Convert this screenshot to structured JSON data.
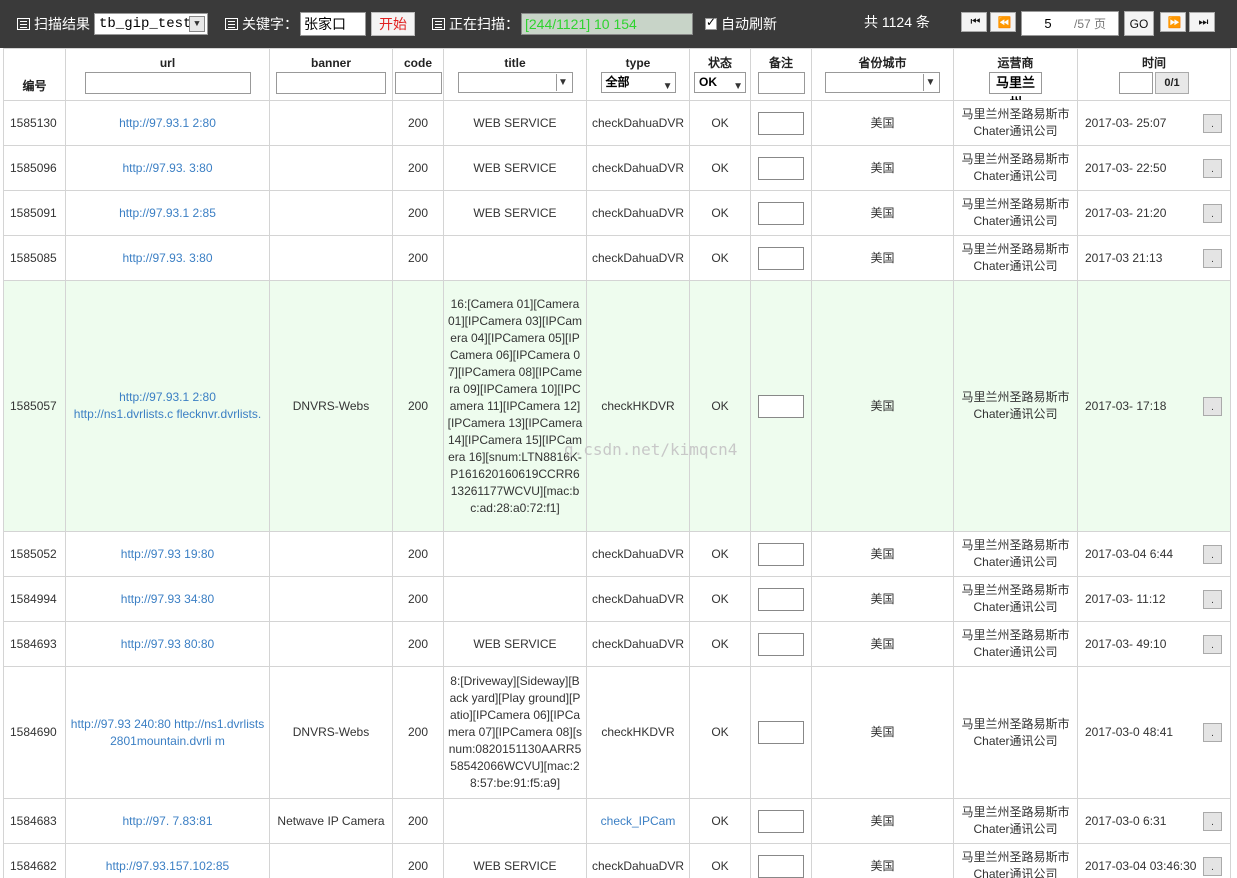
{
  "toolbar": {
    "scan_result_label": "扫描结果",
    "db_select_value": "tb_gip_test",
    "keyword_label": "关键字：",
    "keyword_value": "张家口",
    "start_button": "开始",
    "scanning_label": "正在扫描：",
    "scanning_progress": "[244/1121] 10          154",
    "auto_refresh_label": "自动刷新",
    "total_label": "共 1124 条",
    "first_page": "⏮",
    "prev_page": "⏪",
    "current_page": "5",
    "total_pages": "/57 页",
    "go_button": "GO",
    "next_page": "⏩",
    "last_page": "⏭"
  },
  "table": {
    "headers": {
      "id": "编号",
      "url": "url",
      "banner": "banner",
      "code": "code",
      "title": "title",
      "type": "type",
      "status": "状态",
      "note": "备注",
      "region": "省份城市",
      "isp": "运营商",
      "time": "时间"
    },
    "filters": {
      "type_value": "全部",
      "status_value": "OK",
      "isp_value": "马里兰州",
      "time_page": "0/1"
    },
    "rows": [
      {
        "id": "1585130",
        "url": "http://97.93.1      2:80",
        "banner": "",
        "code": "200",
        "title": "WEB SERVICE",
        "type": "checkDahuaDVR",
        "status": "OK",
        "region": "美国",
        "isp": "马里兰州圣路易斯市Chater通讯公司",
        "time": "2017-03-        25:07"
      },
      {
        "id": "1585096",
        "url": "http://97.93.      3:80",
        "banner": "",
        "code": "200",
        "title": "WEB SERVICE",
        "type": "checkDahuaDVR",
        "status": "OK",
        "region": "美国",
        "isp": "马里兰州圣路易斯市Chater通讯公司",
        "time": "2017-03-        22:50"
      },
      {
        "id": "1585091",
        "url": "http://97.93.1      2:85",
        "banner": "",
        "code": "200",
        "title": "WEB SERVICE",
        "type": "checkDahuaDVR",
        "status": "OK",
        "region": "美国",
        "isp": "马里兰州圣路易斯市Chater通讯公司",
        "time": "2017-03-        21:20"
      },
      {
        "id": "1585085",
        "url": "http://97.93.      3:80",
        "banner": "",
        "code": "200",
        "title": "",
        "type": "checkDahuaDVR",
        "status": "OK",
        "region": "美国",
        "isp": "马里兰州圣路易斯市Chater通讯公司",
        "time": "2017-03        21:13"
      },
      {
        "id": "1585057",
        "url": "http://97.93.1      2:80 http://ns1.dvrlists.c      flecknvr.dvrlists.      ",
        "banner": "DNVRS-Webs",
        "code": "200",
        "title": "16:[Camera 01][Camera 01][IPCamera 03][IPCamera 04][IPCamera 05][IPCamera 06][IPCamera 07][IPCamera 08][IPCamera 09][IPCamera 10][IPCamera 11][IPCamera 12][IPCamera 13][IPCamera 14][IPCamera 15][IPCamera 16][snum:LTN8816K-P161620160619CCRR613261177WCVU][mac:bc:ad:28:a0:72:f1]",
        "type": "checkHKDVR",
        "status": "OK",
        "region": "美国",
        "isp": "马里兰州圣路易斯市Chater通讯公司",
        "time": "2017-03-        17:18",
        "highlight": true
      },
      {
        "id": "1585052",
        "url": "http://97.93      19:80",
        "banner": "",
        "code": "200",
        "title": "",
        "type": "checkDahuaDVR",
        "status": "OK",
        "region": "美国",
        "isp": "马里兰州圣路易斯市Chater通讯公司",
        "time": "2017-03-04       6:44"
      },
      {
        "id": "1584994",
        "url": "http://97.93      34:80",
        "banner": "",
        "code": "200",
        "title": "",
        "type": "checkDahuaDVR",
        "status": "OK",
        "region": "美国",
        "isp": "马里兰州圣路易斯市Chater通讯公司",
        "time": "2017-03-        11:12"
      },
      {
        "id": "1584693",
        "url": "http://97.93      80:80",
        "banner": "",
        "code": "200",
        "title": "WEB SERVICE",
        "type": "checkDahuaDVR",
        "status": "OK",
        "region": "美国",
        "isp": "马里兰州圣路易斯市Chater通讯公司",
        "time": "2017-03-        49:10"
      },
      {
        "id": "1584690",
        "url": "http://97.93      240:80 http://ns1.dvrlists      2801mountain.dvrli      m",
        "banner": "DNVRS-Webs",
        "code": "200",
        "title": "8:[Driveway][Sideway][Back yard][Play ground][Patio][IPCamera 06][IPCamera 07][IPCamera 08][snum:0820151130AARR558542066WCVU][mac:28:57:be:91:f5:a9]",
        "type": "checkHKDVR",
        "status": "OK",
        "region": "美国",
        "isp": "马里兰州圣路易斯市Chater通讯公司",
        "time": "2017-03-0       48:41"
      },
      {
        "id": "1584683",
        "url": "http://97.      7.83:81",
        "banner": "Netwave IP Camera",
        "code": "200",
        "title": "",
        "type": "check_IPCam",
        "type_link": true,
        "status": "OK",
        "region": "美国",
        "isp": "马里兰州圣路易斯市Chater通讯公司",
        "time": "2017-03-0       6:31"
      },
      {
        "id": "1584682",
        "url": "http://97.93.157.102:85",
        "banner": "",
        "code": "200",
        "title": "WEB SERVICE",
        "type": "checkDahuaDVR",
        "status": "OK",
        "region": "美国",
        "isp": "马里兰州圣路易斯市Chater通讯公司",
        "time": "2017-03-04 03:46:30"
      }
    ]
  },
  "watermark": "g.csdn.net/kimqcn4",
  "colors": {
    "toolbar_bg": "#3a3a3a",
    "link": "#3b7fc4",
    "start_button_text": "#e02020",
    "progress_text": "#2fd32f",
    "highlight_row": "#eefcee"
  }
}
